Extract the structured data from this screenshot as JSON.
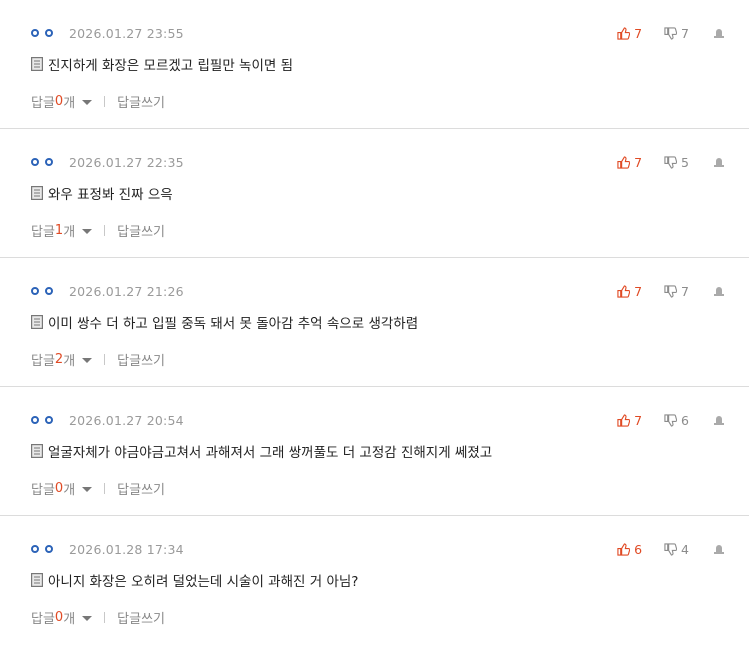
{
  "comments": [
    {
      "date": "2026.01.27 23:55",
      "up": "7",
      "down": "7",
      "text": "진지하게 화장은 모르겠고 립필만 녹이면 됨",
      "reply_prefix": "답글 ",
      "reply_count": "0",
      "reply_suffix": "개",
      "write_label": "답글쓰기"
    },
    {
      "date": "2026.01.27 22:35",
      "up": "7",
      "down": "5",
      "text": "와우 표정봐 진짜 으윽",
      "reply_prefix": "답글 ",
      "reply_count": "1",
      "reply_suffix": "개",
      "write_label": "답글쓰기"
    },
    {
      "date": "2026.01.27 21:26",
      "up": "7",
      "down": "7",
      "text": "이미 쌍수 더 하고 입필 중독 돼서 못 돌아감 추억 속으로 생각하렴",
      "reply_prefix": "답글 ",
      "reply_count": "2",
      "reply_suffix": "개",
      "write_label": "답글쓰기"
    },
    {
      "date": "2026.01.27 20:54",
      "up": "7",
      "down": "6",
      "text": "얼굴자체가 야금야금고쳐서 과해져서 그래 쌍꺼풀도 더 고정감 진해지게 쎄졌고",
      "reply_prefix": "답글 ",
      "reply_count": "0",
      "reply_suffix": "개",
      "write_label": "답글쓰기"
    },
    {
      "date": "2026.01.28 17:34",
      "up": "6",
      "down": "4",
      "text": "아니지 화장은 오히려 덜었는데 시술이 과해진 거 아님?",
      "reply_prefix": "답글 ",
      "reply_count": "0",
      "reply_suffix": "개",
      "write_label": "답글쓰기"
    }
  ],
  "colors": {
    "accent": "#e04a24",
    "nick": "#2c63b8",
    "muted": "#888888"
  },
  "icons": [
    "user-dots-icon",
    "thumbs-up-icon",
    "thumbs-down-icon",
    "report-icon",
    "document-icon",
    "caret-down-icon"
  ]
}
